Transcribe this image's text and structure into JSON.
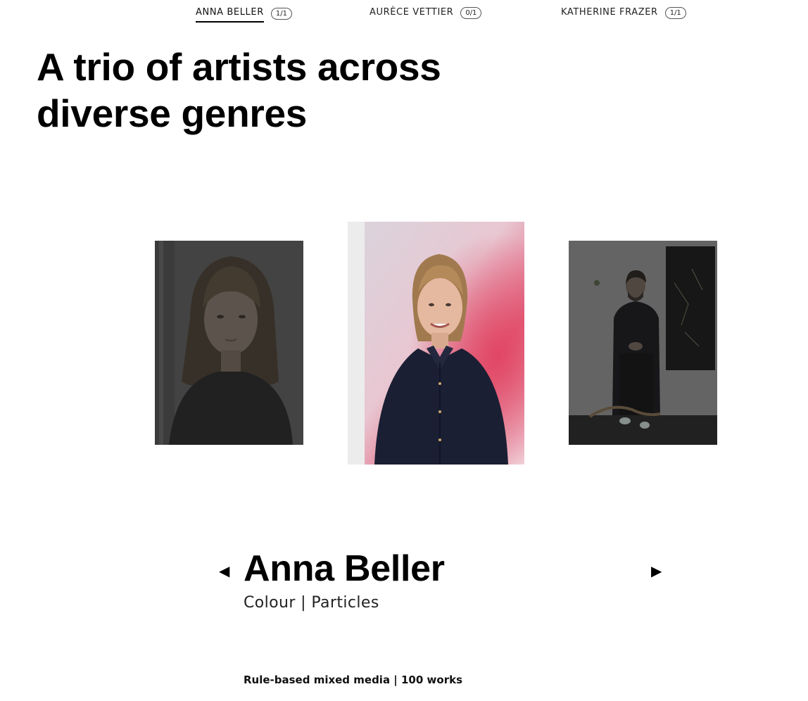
{
  "tabs": [
    {
      "label": "ANNA BELLER",
      "count": "1/1",
      "active": true
    },
    {
      "label": "AURÈCE VETTIER",
      "count": "0/1",
      "active": false
    },
    {
      "label": "KATHERINE FRAZER",
      "count": "1/1",
      "active": false
    }
  ],
  "headline": "A trio of artists across diverse genres",
  "carousel": {
    "portraits": [
      {
        "icon": "portrait-photo-woman-bangs"
      },
      {
        "icon": "portrait-photo-woman-smiling"
      },
      {
        "icon": "portrait-photo-man-suit"
      }
    ],
    "prev_icon": "◀",
    "next_icon": "▶"
  },
  "artist": {
    "name": "Anna Beller",
    "tags": "Colour | Particles",
    "meta": "Rule-based mixed media | 100 works"
  },
  "colors": {
    "background": "#ffffff",
    "text": "#000000",
    "dim_overlay": "#808080"
  }
}
